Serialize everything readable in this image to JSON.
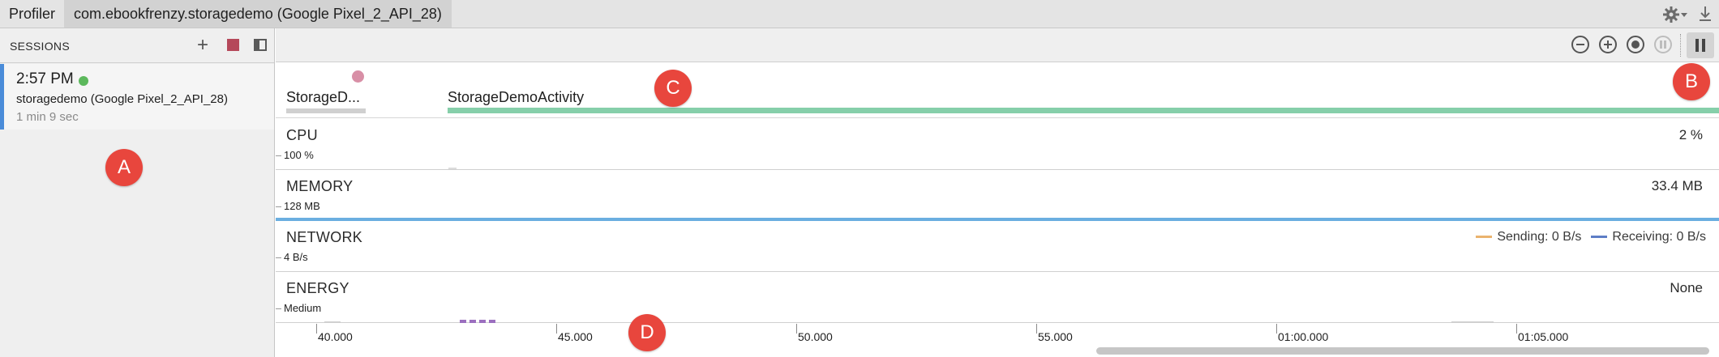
{
  "tabs": {
    "profiler": "Profiler",
    "session": "com.ebookfrenzy.storagedemo (Google Pixel_2_API_28)"
  },
  "tab_icons": {
    "settings": "gear-icon",
    "download": "download-icon"
  },
  "sidebar": {
    "title": "SESSIONS",
    "icons": {
      "add": "+",
      "stop": "stop-icon",
      "panel": "panel-toggle-icon"
    },
    "session": {
      "time": "2:57 PM",
      "name": "storagedemo (Google Pixel_2_API_28)",
      "duration": "1 min 9 sec",
      "live_color": "#5cb85c"
    }
  },
  "toolbar": {
    "icons": [
      "zoom-out-icon",
      "zoom-in-icon",
      "reset-zoom-icon",
      "live-icon",
      "pause-icon"
    ]
  },
  "activities": [
    {
      "label": "StorageD..."
    },
    {
      "label": "StorageDemoActivity",
      "color": "#86cfaa"
    }
  ],
  "monitors": {
    "cpu": {
      "title": "CPU",
      "axis": "100 %",
      "value": "2 %"
    },
    "memory": {
      "title": "MEMORY",
      "axis": "128 MB",
      "value": "33.4 MB",
      "color": "#6aaee0"
    },
    "network": {
      "title": "NETWORK",
      "axis": "4 B/s",
      "sending": "Sending: 0 B/s",
      "receiving": "Receiving: 0 B/s",
      "sending_color": "#eab36e",
      "receiving_color": "#5d7dc6"
    },
    "energy": {
      "title": "ENERGY",
      "axis": "Medium",
      "value": "None",
      "mark_color": "#9b6fbf"
    }
  },
  "time_axis": {
    "labels": [
      "40.000",
      "45.000",
      "50.000",
      "55.000",
      "01:00.000",
      "01:05.000"
    ]
  },
  "callouts": {
    "a": "A",
    "b": "B",
    "c": "C",
    "d": "D"
  }
}
